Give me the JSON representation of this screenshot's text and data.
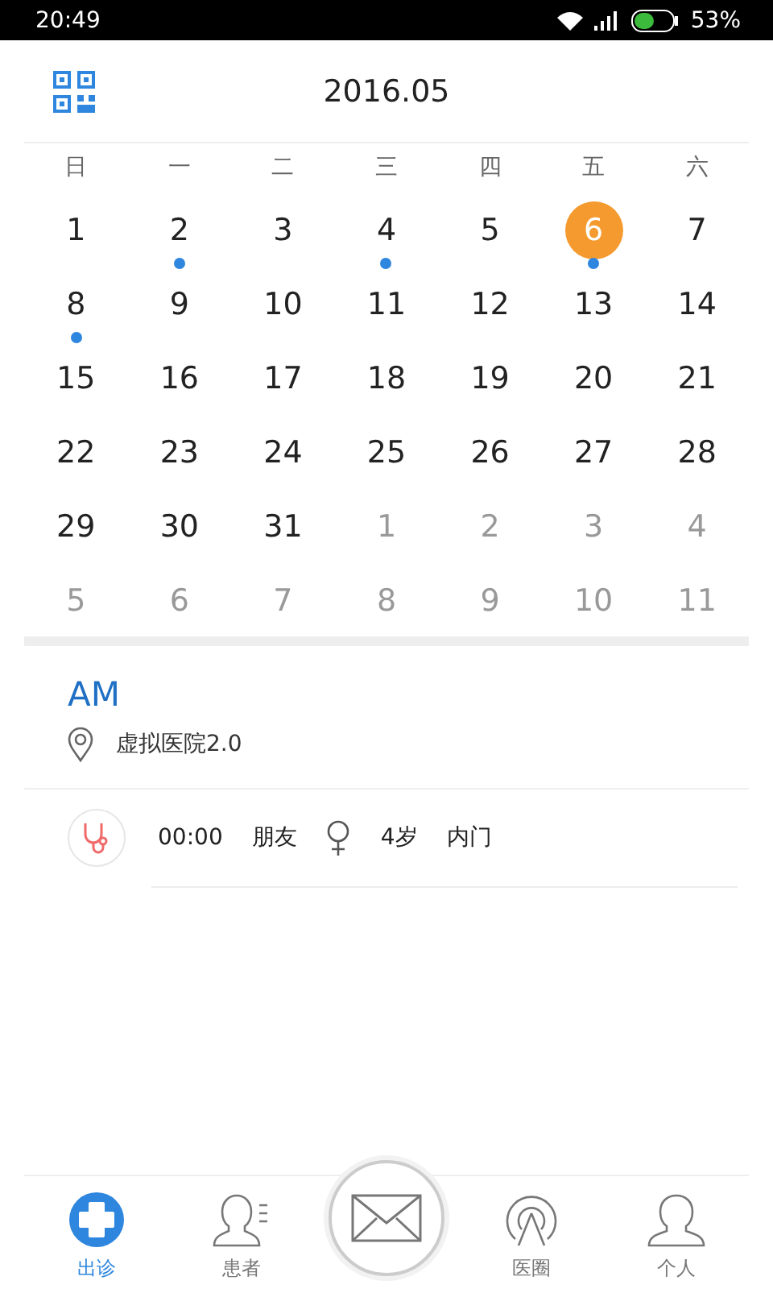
{
  "status_bar": {
    "time": "20:49",
    "battery_text": "53%"
  },
  "header": {
    "title": "2016.05"
  },
  "weekdays": [
    "日",
    "一",
    "二",
    "三",
    "四",
    "五",
    "六"
  ],
  "days": [
    {
      "text": "1",
      "muted": false,
      "selected": false,
      "dot": false
    },
    {
      "text": "2",
      "muted": false,
      "selected": false,
      "dot": true
    },
    {
      "text": "3",
      "muted": false,
      "selected": false,
      "dot": false
    },
    {
      "text": "4",
      "muted": false,
      "selected": false,
      "dot": true
    },
    {
      "text": "5",
      "muted": false,
      "selected": false,
      "dot": false
    },
    {
      "text": "6",
      "muted": false,
      "selected": true,
      "dot": true
    },
    {
      "text": "7",
      "muted": false,
      "selected": false,
      "dot": false
    },
    {
      "text": "8",
      "muted": false,
      "selected": false,
      "dot": true
    },
    {
      "text": "9",
      "muted": false,
      "selected": false,
      "dot": false
    },
    {
      "text": "10",
      "muted": false,
      "selected": false,
      "dot": false
    },
    {
      "text": "11",
      "muted": false,
      "selected": false,
      "dot": false
    },
    {
      "text": "12",
      "muted": false,
      "selected": false,
      "dot": false
    },
    {
      "text": "13",
      "muted": false,
      "selected": false,
      "dot": false
    },
    {
      "text": "14",
      "muted": false,
      "selected": false,
      "dot": false
    },
    {
      "text": "15",
      "muted": false,
      "selected": false,
      "dot": false
    },
    {
      "text": "16",
      "muted": false,
      "selected": false,
      "dot": false
    },
    {
      "text": "17",
      "muted": false,
      "selected": false,
      "dot": false
    },
    {
      "text": "18",
      "muted": false,
      "selected": false,
      "dot": false
    },
    {
      "text": "19",
      "muted": false,
      "selected": false,
      "dot": false
    },
    {
      "text": "20",
      "muted": false,
      "selected": false,
      "dot": false
    },
    {
      "text": "21",
      "muted": false,
      "selected": false,
      "dot": false
    },
    {
      "text": "22",
      "muted": false,
      "selected": false,
      "dot": false
    },
    {
      "text": "23",
      "muted": false,
      "selected": false,
      "dot": false
    },
    {
      "text": "24",
      "muted": false,
      "selected": false,
      "dot": false
    },
    {
      "text": "25",
      "muted": false,
      "selected": false,
      "dot": false
    },
    {
      "text": "26",
      "muted": false,
      "selected": false,
      "dot": false
    },
    {
      "text": "27",
      "muted": false,
      "selected": false,
      "dot": false
    },
    {
      "text": "28",
      "muted": false,
      "selected": false,
      "dot": false
    },
    {
      "text": "29",
      "muted": false,
      "selected": false,
      "dot": false
    },
    {
      "text": "30",
      "muted": false,
      "selected": false,
      "dot": false
    },
    {
      "text": "31",
      "muted": false,
      "selected": false,
      "dot": false
    },
    {
      "text": "1",
      "muted": true,
      "selected": false,
      "dot": false
    },
    {
      "text": "2",
      "muted": true,
      "selected": false,
      "dot": false
    },
    {
      "text": "3",
      "muted": true,
      "selected": false,
      "dot": false
    },
    {
      "text": "4",
      "muted": true,
      "selected": false,
      "dot": false
    },
    {
      "text": "5",
      "muted": true,
      "selected": false,
      "dot": false
    },
    {
      "text": "6",
      "muted": true,
      "selected": false,
      "dot": false
    },
    {
      "text": "7",
      "muted": true,
      "selected": false,
      "dot": false
    },
    {
      "text": "8",
      "muted": true,
      "selected": false,
      "dot": false
    },
    {
      "text": "9",
      "muted": true,
      "selected": false,
      "dot": false
    },
    {
      "text": "10",
      "muted": true,
      "selected": false,
      "dot": false
    },
    {
      "text": "11",
      "muted": true,
      "selected": false,
      "dot": false
    }
  ],
  "session": {
    "period": "AM",
    "location": "虚拟医院2.0"
  },
  "appointments": [
    {
      "time": "00:00",
      "name": "朋友",
      "age": "4岁",
      "department": "内门"
    }
  ],
  "tabs": [
    {
      "kind": "clinic",
      "label": "出诊",
      "selected": true
    },
    {
      "kind": "patients",
      "label": "患者",
      "selected": false
    },
    {
      "kind": "mail",
      "selected": false
    },
    {
      "kind": "circle",
      "label": "医圈",
      "selected": false
    },
    {
      "kind": "person",
      "label": "个人",
      "selected": false
    }
  ]
}
